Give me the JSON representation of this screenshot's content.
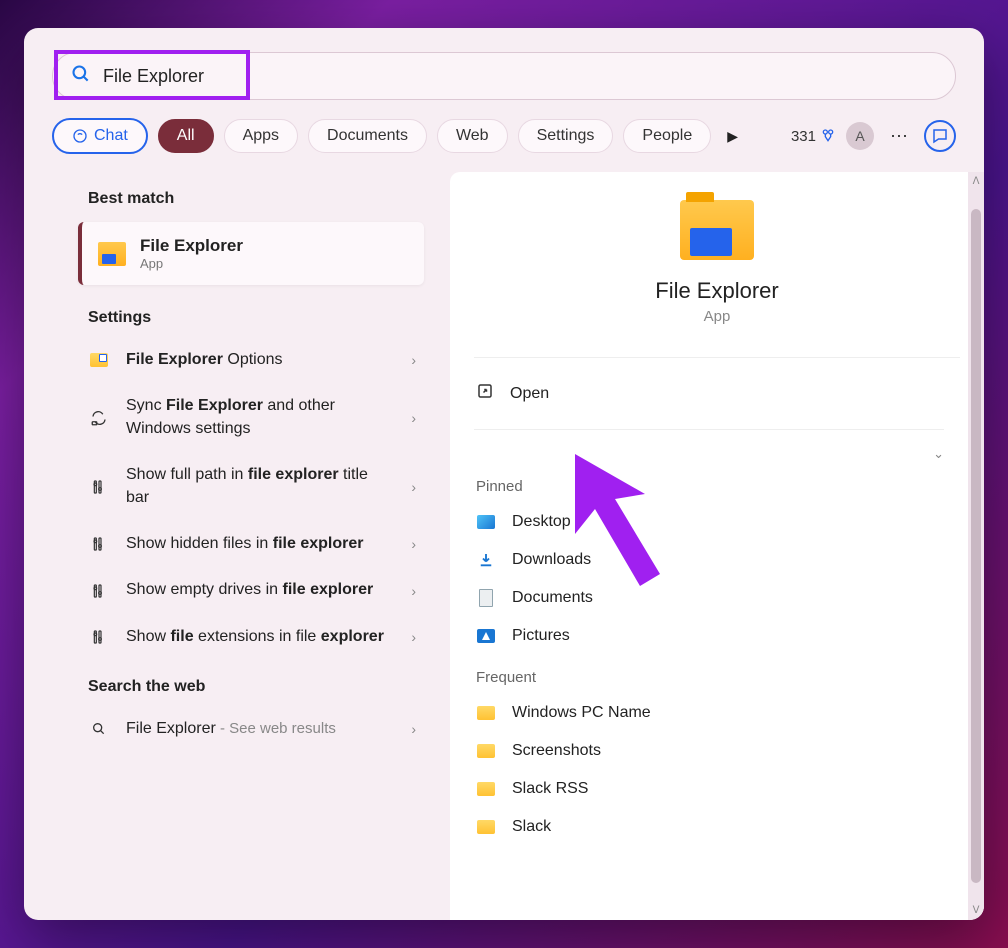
{
  "search": {
    "value": "File Explorer"
  },
  "filters": {
    "chat": "Chat",
    "all": "All",
    "apps": "Apps",
    "documents": "Documents",
    "web": "Web",
    "settings": "Settings",
    "people": "People"
  },
  "rewards": {
    "points": "331"
  },
  "avatar": {
    "initial": "A"
  },
  "left": {
    "best_match_label": "Best match",
    "best_match": {
      "title": "File Explorer",
      "subtitle": "App"
    },
    "settings_label": "Settings",
    "settings_items": [
      {
        "html": "<strong>File Explorer</strong> Options"
      },
      {
        "html": "Sync <strong>File Explorer</strong> and other Windows settings"
      },
      {
        "html": "Show full path in <strong>file explorer</strong> title bar"
      },
      {
        "html": "Show hidden files in <strong>file explorer</strong>"
      },
      {
        "html": "Show empty drives in <strong>file explorer</strong>"
      },
      {
        "html": "Show <strong>file</strong> extensions in file <strong>explorer</strong>"
      }
    ],
    "web_label": "Search the web",
    "web_item": {
      "title": "File Explorer",
      "suffix": " - See web results"
    }
  },
  "right": {
    "title": "File Explorer",
    "subtitle": "App",
    "open_label": "Open",
    "pinned_label": "Pinned",
    "pinned": [
      "Desktop",
      "Downloads",
      "Documents",
      "Pictures"
    ],
    "frequent_label": "Frequent",
    "frequent": [
      "Windows PC Name",
      "Screenshots",
      "Slack RSS",
      "Slack"
    ]
  }
}
